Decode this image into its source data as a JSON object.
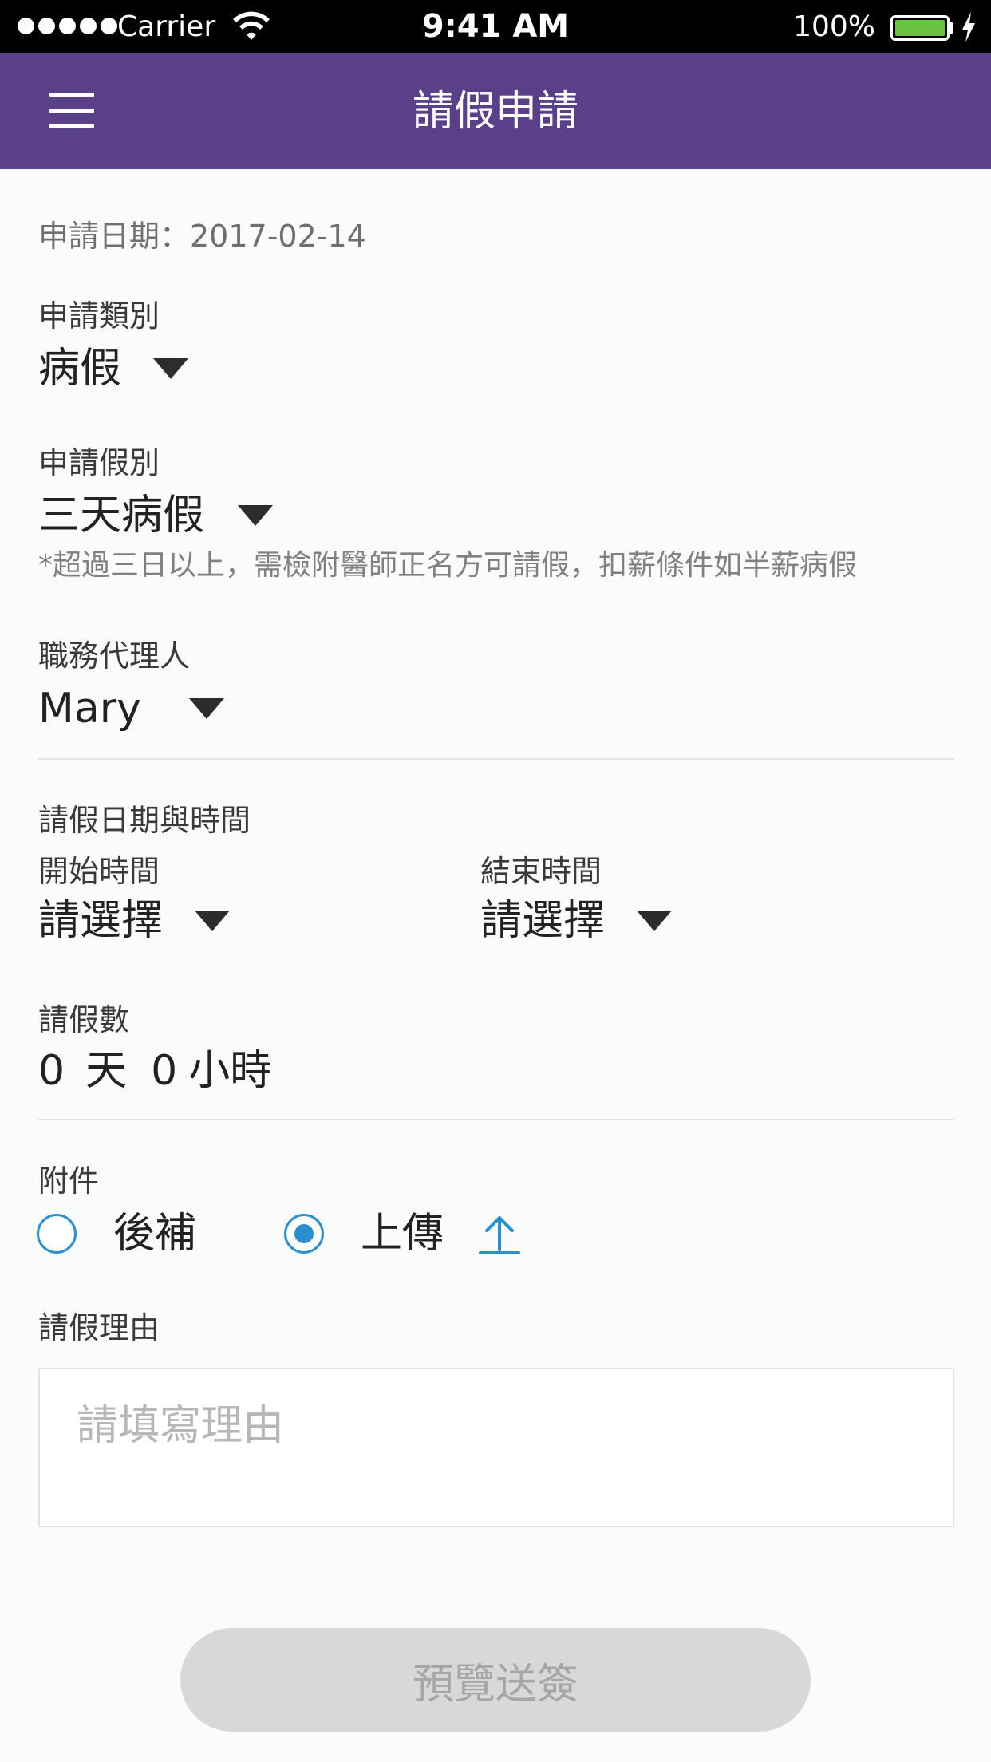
{
  "status_bar": {
    "carrier": "Carrier",
    "time": "9:41 AM",
    "battery": "100%",
    "signal_icon": "signal-dots-icon",
    "wifi_icon": "wifi-icon",
    "battery_icon": "battery-icon",
    "charging_icon": "charging-bolt-icon"
  },
  "nav": {
    "title": "請假申請",
    "menu_icon": "hamburger-menu-icon",
    "background": "#5a4089"
  },
  "form": {
    "apply_date": "申請日期：2017-02-14",
    "category": {
      "label": "申請類別",
      "value": "病假"
    },
    "leave_type": {
      "label": "申請假別",
      "value": "三天病假",
      "note": "*超過三日以上，需檢附醫師正名方可請假，扣薪條件如半薪病假"
    },
    "agent": {
      "label": "職務代理人",
      "value": "Mary"
    },
    "datetime": {
      "label": "請假日期與時間",
      "start_label": "開始時間",
      "start_value": "請選擇",
      "end_label": "結束時間",
      "end_value": "請選擇"
    },
    "count": {
      "label": "請假數",
      "days": "0",
      "days_unit": "天",
      "hours": "0",
      "hours_unit": "小時"
    },
    "attachment": {
      "label": "附件",
      "option_later": "後補",
      "option_upload": "上傳",
      "selected": "上傳",
      "upload_icon": "upload-arrow-icon",
      "accent": "#2a8fcc"
    },
    "reason": {
      "label": "請假理由",
      "placeholder": "請填寫理由",
      "value": ""
    }
  },
  "submit": {
    "label": "預覽送簽",
    "background": "#d8d8d8"
  }
}
